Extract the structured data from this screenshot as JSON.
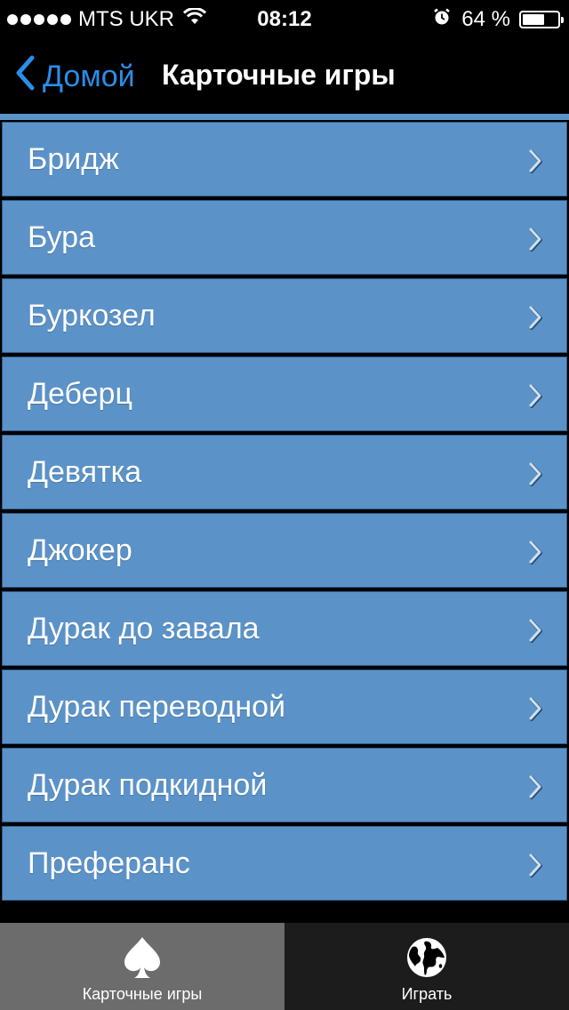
{
  "status_bar": {
    "carrier": "MTS UKR",
    "time": "08:12",
    "battery_percent_text": "64 %",
    "battery_level": 0.64,
    "icons": [
      "signal-dots-icon",
      "wifi-icon",
      "alarm-icon",
      "battery-icon"
    ]
  },
  "nav": {
    "back_label": "Домой",
    "title": "Карточные игры"
  },
  "list": {
    "items": [
      {
        "label": "Бридж"
      },
      {
        "label": "Бура"
      },
      {
        "label": "Буркозел"
      },
      {
        "label": "Деберц"
      },
      {
        "label": "Девятка"
      },
      {
        "label": "Джокер"
      },
      {
        "label": "Дурак до завала"
      },
      {
        "label": "Дурак переводной"
      },
      {
        "label": "Дурак подкидной"
      },
      {
        "label": "Преферанс"
      }
    ]
  },
  "tabs": [
    {
      "label": "Карточные игры",
      "icon": "spade-icon",
      "active": true
    },
    {
      "label": "Играть",
      "icon": "globe-icon",
      "active": false
    }
  ],
  "colors": {
    "accent": "#2b8de9",
    "row_background": "#5b93c9",
    "tab_active": "#6c6c6c",
    "tab_inactive": "#1c1c1c"
  }
}
